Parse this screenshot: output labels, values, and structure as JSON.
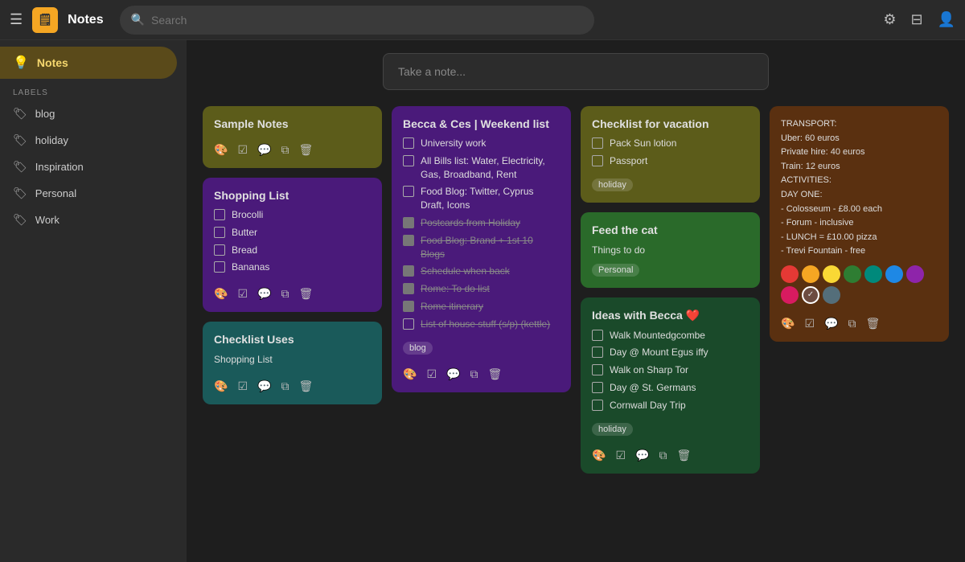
{
  "topbar": {
    "title": "Notes",
    "logo_text": "🗒",
    "search_placeholder": "Search",
    "icons": {
      "menu": "☰",
      "settings": "⚙",
      "layout": "⊟",
      "account": "👤"
    }
  },
  "sidebar": {
    "notes_label": "Notes",
    "section_label": "LABELS",
    "items": [
      {
        "label": "blog",
        "id": "blog"
      },
      {
        "label": "holiday",
        "id": "holiday"
      },
      {
        "label": "Inspiration",
        "id": "inspiration"
      },
      {
        "label": "Personal",
        "id": "personal"
      },
      {
        "label": "Work",
        "id": "work"
      }
    ]
  },
  "take_note_placeholder": "Take a note...",
  "notes": {
    "sample_notes": {
      "title": "Sample Notes",
      "color": "card-olive"
    },
    "shopping_list": {
      "title": "Shopping List",
      "color": "card-purple",
      "items": [
        {
          "text": "Brocolli",
          "checked": false
        },
        {
          "text": "Butter",
          "checked": false
        },
        {
          "text": "Bread",
          "checked": false
        },
        {
          "text": "Bananas",
          "checked": false
        }
      ]
    },
    "checklist_uses": {
      "title": "Checklist Uses",
      "body": "Shopping List",
      "color": "card-teal"
    },
    "becca_weekend": {
      "title": "Becca & Ces | Weekend list",
      "color": "card-purple",
      "items": [
        {
          "text": "University work",
          "checked": false,
          "strikethrough": false
        },
        {
          "text": "All Bills list: Water, Electricity, Gas, Broadband, Rent",
          "checked": false,
          "strikethrough": false
        },
        {
          "text": "Food Blog: Twitter, Cyprus Draft, Icons",
          "checked": false,
          "strikethrough": false
        },
        {
          "text": "Postcards from Holiday",
          "checked": true,
          "strikethrough": true
        },
        {
          "text": "Food Blog: Brand + 1st 10 Blogs",
          "checked": true,
          "strikethrough": true
        },
        {
          "text": "Schedule when back",
          "checked": true,
          "strikethrough": true
        },
        {
          "text": "Rome: To do list",
          "checked": true,
          "strikethrough": true
        },
        {
          "text": "Rome itinerary",
          "checked": true,
          "strikethrough": true
        },
        {
          "text": "List of house stuff (s/p) (kettle)",
          "checked": false,
          "strikethrough": true
        }
      ],
      "tag": "blog"
    },
    "checklist_vacation": {
      "title": "Checklist for vacation",
      "color": "card-olive",
      "items": [
        {
          "text": "Pack Sun lotion",
          "checked": false
        },
        {
          "text": "Passport",
          "checked": false
        }
      ],
      "tag": "holiday"
    },
    "feed_cat": {
      "title": "Feed the cat",
      "body": "Things to do",
      "color": "card-green",
      "tag": "Personal"
    },
    "ideas_becca": {
      "title": "Ideas with Becca ❤️",
      "color": "card-dark-green",
      "items": [
        {
          "text": "Walk Mountedgcombe",
          "checked": false
        },
        {
          "text": "Day @ Mount Egus iffy",
          "checked": false
        },
        {
          "text": "Walk on Sharp Tor",
          "checked": false
        },
        {
          "text": "Day @ St. Germans",
          "checked": false
        },
        {
          "text": "Cornwall Day Trip",
          "checked": false
        }
      ],
      "tag": "holiday"
    },
    "transport": {
      "color": "card-brown",
      "body_lines": [
        "TRANSPORT:",
        "Uber: 60 euros",
        "Private hire: 40 euros",
        "Train: 12 euros",
        "ACTIVITIES:",
        "DAY ONE:",
        "- Colosseum - £8.00 each",
        "- Forum - inclusive",
        "- LUNCH = £10.00 pizza",
        "- Trevi Fountain - free"
      ],
      "colors": [
        {
          "hex": "#e53935",
          "selected": false
        },
        {
          "hex": "#f5a623",
          "selected": false
        },
        {
          "hex": "#f9d835",
          "selected": false
        },
        {
          "hex": "#2e7d32",
          "selected": false
        },
        {
          "hex": "#00897b",
          "selected": false
        },
        {
          "hex": "#1e88e5",
          "selected": false
        },
        {
          "hex": "#8e24aa",
          "selected": false
        },
        {
          "hex": "#d81b60",
          "selected": false
        },
        {
          "hex": "#6d4c41",
          "selected": true
        },
        {
          "hex": "#546e7a",
          "selected": false
        }
      ]
    }
  }
}
